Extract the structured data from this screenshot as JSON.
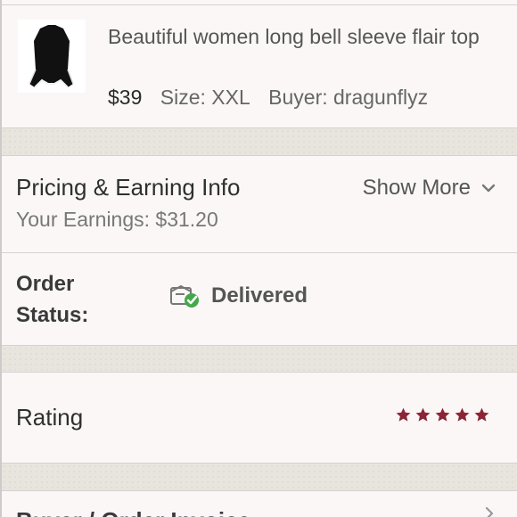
{
  "item": {
    "title": "Beautiful women long bell sleeve flair top",
    "price": "$39",
    "size": "Size: XXL",
    "buyer": "Buyer: dragunflyz"
  },
  "pricing": {
    "title": "Pricing & Earning Info",
    "show_more": "Show More",
    "earnings": "Your Earnings: $31.20"
  },
  "order_status": {
    "label": "Order Status:",
    "value": "Delivered"
  },
  "rating": {
    "label": "Rating",
    "stars": 5
  },
  "next_section": {
    "label": "Buyer / Order Invoice"
  },
  "colors": {
    "star": "#8b2535",
    "check": "#43a84b",
    "gap": "#e8e5df"
  },
  "icons": {
    "chevron": "chevron-down-icon",
    "status": "delivered-box-icon",
    "star": "star-icon"
  }
}
